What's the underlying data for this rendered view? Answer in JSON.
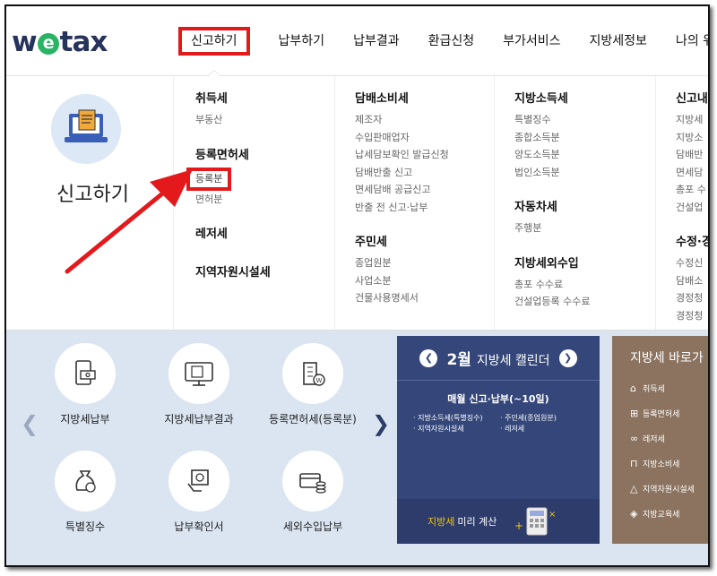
{
  "logo": "wetax",
  "nav": [
    "신고하기",
    "납부하기",
    "납부결과",
    "환급신청",
    "부가서비스",
    "지방세정보",
    "나의 위택스"
  ],
  "mega": {
    "title": "신고하기",
    "col1": {
      "cat1": "취득세",
      "cat1_items": [
        "부동산"
      ],
      "cat2": "등록면허세",
      "cat2_items": [
        "등록분",
        "면허분"
      ],
      "cat3": "레저세",
      "cat4": "지역자원시설세"
    },
    "col2": {
      "cat1": "담배소비세",
      "cat1_items": [
        "제조자",
        "수입판매업자",
        "납세담보확인 발급신청",
        "담배반출 신고",
        "면세담배 공급신고",
        "반출 전 신고·납부"
      ],
      "cat2": "주민세",
      "cat2_items": [
        "종업원분",
        "사업소분",
        "건물사용명세서"
      ]
    },
    "col3": {
      "cat1": "지방소득세",
      "cat1_items": [
        "특별징수",
        "종합소득분",
        "양도소득분",
        "법인소득분"
      ],
      "cat2": "자동차세",
      "cat2_items": [
        "주행분"
      ],
      "cat3": "지방세외수입",
      "cat3_items": [
        "총포 수수료",
        "건설업등록 수수료"
      ]
    },
    "col4": {
      "cat1": "신고내",
      "cat1_items": [
        "지방세",
        "지방소",
        "담배반",
        "면세담",
        "총포 수",
        "건설업"
      ],
      "cat2": "수정·경",
      "cat2_items": [
        "수정신",
        "담배소",
        "경정청",
        "경정청"
      ]
    }
  },
  "services": [
    "지방세납부",
    "지방세납부결과",
    "등록면허세(등록분)",
    "특별징수",
    "납부확인서",
    "세외수입납부"
  ],
  "calendar": {
    "month": "2월",
    "title": "지방세 캘린더",
    "subtitle": "매월 신고·납부(~10일)",
    "items": [
      "· 지방소득세(특별징수)",
      "· 주민세(종업원분)",
      "· 지역자원시설세",
      "· 레저세"
    ],
    "footer_highlight": "지방세",
    "footer_rest": "미리 계산"
  },
  "shortcut": {
    "title": "지방세 바로가",
    "items": [
      "취득세",
      "등록면허세",
      "레저세",
      "지방소비세",
      "지역자원시설세",
      "지방교육세"
    ]
  },
  "colors": {
    "highlight": "#e3191c",
    "navy": "#35477a",
    "brown": "#8b7360",
    "panel": "#dbe5f2"
  }
}
